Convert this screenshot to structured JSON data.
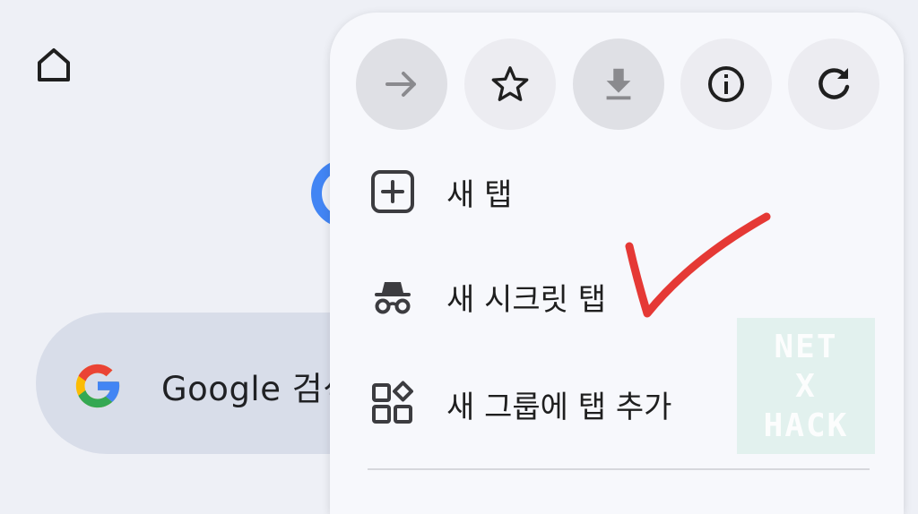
{
  "background": {
    "home_icon": "home-icon",
    "search": {
      "text": "Google 검색",
      "logo": "google-g-logo"
    }
  },
  "menu": {
    "action_buttons": [
      {
        "name": "forward",
        "icon": "arrow-right-icon"
      },
      {
        "name": "bookmark",
        "icon": "star-icon"
      },
      {
        "name": "download",
        "icon": "download-icon"
      },
      {
        "name": "page-info",
        "icon": "info-icon"
      },
      {
        "name": "reload",
        "icon": "refresh-icon"
      }
    ],
    "items": [
      {
        "label": "새 탭",
        "icon": "plus-box-icon"
      },
      {
        "label": "새 시크릿 탭",
        "icon": "incognito-icon"
      },
      {
        "label": "새 그룹에 탭 추가",
        "icon": "tab-group-icon"
      }
    ]
  },
  "watermark": {
    "lines": [
      "NET",
      "X",
      "HACK"
    ]
  },
  "annotation": {
    "color": "#e53935",
    "shape": "checkmark"
  },
  "colors": {
    "background": "#eef0f6",
    "menu": "#f7f8fc",
    "search_bar": "#d8dde9"
  }
}
